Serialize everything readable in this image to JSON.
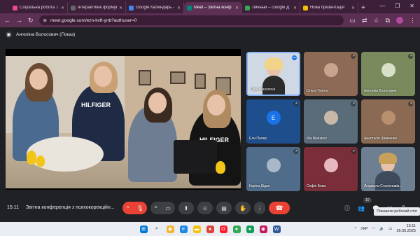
{
  "browser": {
    "tabs": [
      {
        "title": "Соціальна робота 7.0",
        "color": "#e94b8b",
        "active": false
      },
      {
        "title": "Інтерактивні формування",
        "color": "#444",
        "active": false
      },
      {
        "title": "Google Календарь - ",
        "color": "#4285f4",
        "active": false
      },
      {
        "title": "Meet – Звітна конф",
        "color": "#00897b",
        "active": true
      },
      {
        "title": "Личный – Google Д",
        "color": "#34a853",
        "active": false
      },
      {
        "title": "Нова презентація",
        "color": "#fbbc04",
        "active": false
      }
    ],
    "url": "meet.google.com/ezn-kvft-ynb?authuser=0"
  },
  "meet": {
    "presenter_label": "Ангеліна Волосович (Показ)",
    "participants": [
      {
        "name": "Olga Boryssova",
        "bg": "#cfd8e3",
        "avatar": "",
        "avatar_color": ""
      },
      {
        "name": "Ольга Тупота",
        "bg": "#8d6a55",
        "avatar": "",
        "avatar_color": "#c9a48c"
      },
      {
        "name": "Ангеліна Волосович",
        "bg": "#7a8a5c",
        "avatar": "",
        "avatar_color": "#d8e0c8"
      },
      {
        "name": "Ели Полер",
        "bg": "#1f4e8c",
        "avatar": "E",
        "avatar_color": "#1a73e8"
      },
      {
        "name": "Illia Bieliakov",
        "bg": "#5a6b7a",
        "avatar": "",
        "avatar_color": "#c9b8a8"
      },
      {
        "name": "Анастасія Шевченко",
        "bg": "#8a6a52",
        "avatar": "",
        "avatar_color": "#b89070"
      },
      {
        "name": "Каріна Дідак",
        "bg": "#4f6d8a",
        "avatar": "",
        "avatar_color": "#a8b8c8"
      },
      {
        "name": "Софія Бова",
        "bg": "#7a2e3a",
        "avatar": "",
        "avatar_color": "#e8b8c0"
      },
      {
        "name": "Людмила Станіславів...",
        "bg": "#6f7f92",
        "avatar": "",
        "avatar_color": ""
      }
    ],
    "time": "15:11",
    "meeting_title": "Звітна конференція з психокорекційн...",
    "participant_count": "10",
    "tooltip": "Показати робочий стіл"
  },
  "system": {
    "lang": "УКР",
    "time": "15:11",
    "date": "26.05.2025"
  }
}
